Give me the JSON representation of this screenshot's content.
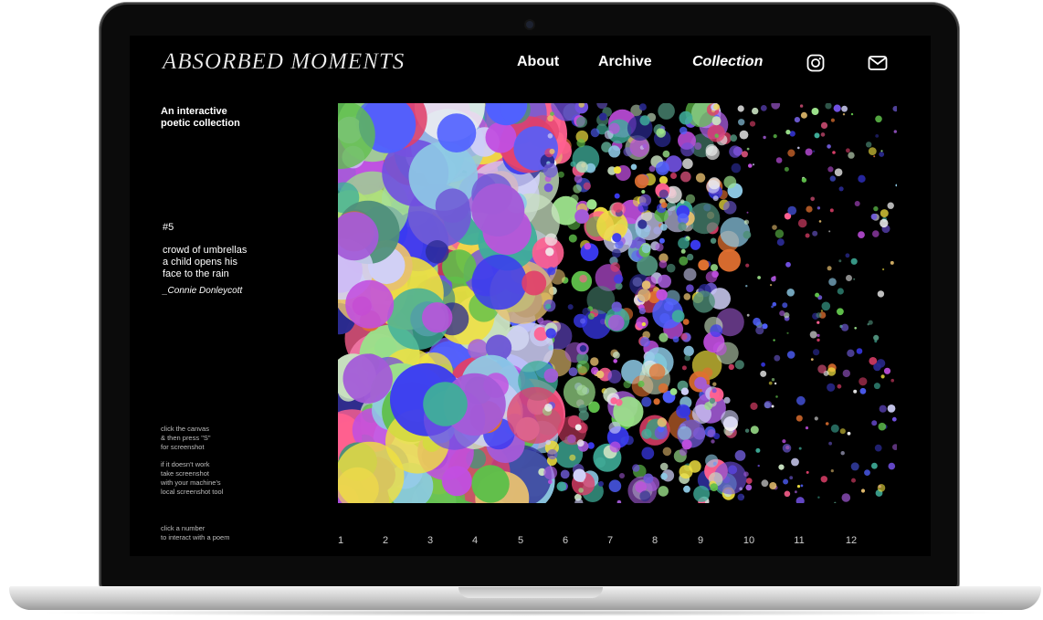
{
  "site": {
    "logo": "ABSORBED MOMENTS",
    "nav": {
      "about": "About",
      "archive": "Archive",
      "collection": "Collection"
    },
    "icons": [
      "instagram-icon",
      "mail-icon"
    ]
  },
  "sidebar": {
    "tagline_lines": [
      "An interactive",
      "poetic collection"
    ],
    "poem_number": "#5",
    "poem_lines": [
      "crowd of umbrellas",
      "a child opens his",
      "face to the rain"
    ],
    "poem_author": "_Connie Donleycott",
    "hint_screenshot": [
      "click the canvas",
      "& then press \"S\"",
      "for screenshot"
    ],
    "hint_fallback": [
      "if it doesn't work",
      "take screenshot",
      "with your machine's",
      "local screenshot tool"
    ],
    "hint_numbers": [
      "click a number",
      "to interact with a poem"
    ]
  },
  "poem_selector": [
    "1",
    "2",
    "3",
    "4",
    "5",
    "6",
    "7",
    "8",
    "9",
    "10",
    "11",
    "12"
  ],
  "colors": {
    "background": "#000000",
    "text": "#ffffff",
    "palette": [
      "#6f5bd6",
      "#3a3af0",
      "#c14fe0",
      "#5fbf4a",
      "#e0406a",
      "#4f8f7a",
      "#a45bd8",
      "#f0e040",
      "#e07030",
      "#8ecae6",
      "#2a2a90",
      "#c8e0c0"
    ]
  }
}
